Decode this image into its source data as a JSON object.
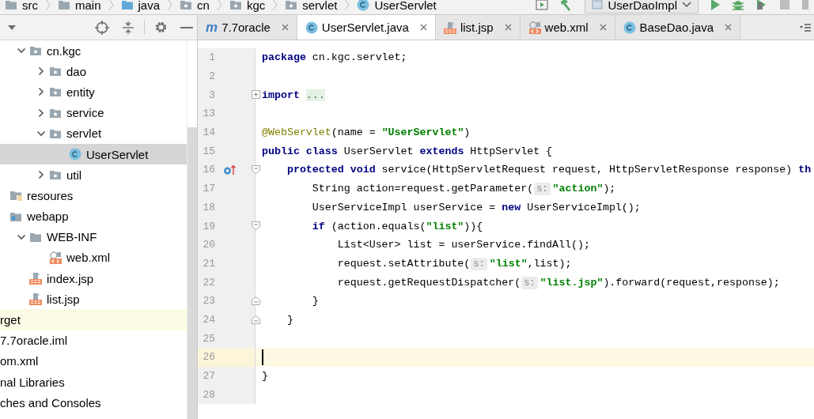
{
  "breadcrumbs": [
    {
      "kind": "folder",
      "label": "src"
    },
    {
      "kind": "folder",
      "label": "main"
    },
    {
      "kind": "source-root",
      "label": "java"
    },
    {
      "kind": "package",
      "label": "cn"
    },
    {
      "kind": "package",
      "label": "kgc"
    },
    {
      "kind": "package",
      "label": "servlet"
    },
    {
      "kind": "class",
      "label": "UserServlet"
    }
  ],
  "run_configuration": {
    "label": "UserDaoImpl"
  },
  "project_tree": [
    {
      "kind": "offscreen",
      "children": [
        {
          "kind": "offscreen",
          "children": [
            {
              "kind": "offscreen",
              "children": [
                {
                  "kind": "package",
                  "label": "cn.kgc",
                  "expanded": true,
                  "selected": false,
                  "excluded": false,
                  "children": [
                    {
                      "kind": "package",
                      "label": "dao",
                      "expanded": false,
                      "selected": false,
                      "excluded": false
                    },
                    {
                      "kind": "package",
                      "label": "entity",
                      "expanded": false,
                      "selected": false,
                      "excluded": false
                    },
                    {
                      "kind": "package",
                      "label": "service",
                      "expanded": false,
                      "selected": false,
                      "excluded": false
                    },
                    {
                      "kind": "package",
                      "label": "servlet",
                      "expanded": true,
                      "selected": false,
                      "excluded": false,
                      "children": [
                        {
                          "kind": "class",
                          "label": "UserServlet",
                          "selected": true,
                          "excluded": false
                        }
                      ]
                    },
                    {
                      "kind": "package",
                      "label": "util",
                      "expanded": false,
                      "selected": false,
                      "excluded": false
                    }
                  ]
                }
              ]
            },
            {
              "kind": "resources",
              "label": "resoures",
              "selected": false,
              "excluded": false
            },
            {
              "kind": "webroot",
              "label": "webapp",
              "selected": false,
              "excluded": false,
              "children": [
                {
                  "kind": "folder",
                  "label": "WEB-INF",
                  "expanded": true,
                  "selected": false,
                  "excluded": false,
                  "children": [
                    {
                      "kind": "xml",
                      "label": "web.xml",
                      "selected": false,
                      "excluded": false
                    }
                  ]
                },
                {
                  "kind": "jsp",
                  "label": "index.jsp",
                  "selected": false,
                  "excluded": false
                },
                {
                  "kind": "jsp",
                  "label": "list.jsp",
                  "selected": false,
                  "excluded": false
                }
              ]
            }
          ]
        }
      ]
    },
    {
      "kind": "folder",
      "label": "rget",
      "selected": false,
      "excluded": true
    },
    {
      "kind": "module-file",
      "label": "7.7oracle.iml",
      "selected": false,
      "excluded": false
    },
    {
      "kind": "xml",
      "label": "om.xml",
      "selected": false,
      "excluded": false
    },
    {
      "kind": "libraries",
      "label": "nal Libraries",
      "selected": false,
      "excluded": false
    },
    {
      "kind": "scratches",
      "label": "ches and Consoles",
      "selected": false,
      "excluded": false
    }
  ],
  "tabs": [
    {
      "kind": "module",
      "icon_text": "m",
      "label": "7.7oracle",
      "selected": false
    },
    {
      "kind": "class",
      "label": "UserServlet.java",
      "selected": true
    },
    {
      "kind": "jsp",
      "label": "list.jsp",
      "selected": false
    },
    {
      "kind": "xml",
      "label": "web.xml",
      "selected": false
    },
    {
      "kind": "class",
      "label": "BaseDao.java",
      "selected": false
    }
  ],
  "editor": {
    "lines": [
      {
        "number": "1",
        "current": false,
        "segments": [
          {
            "kind": "keyword",
            "text": "package"
          },
          {
            "kind": "plain",
            "text": " cn.kgc.servlet;"
          }
        ]
      },
      {
        "number": "2",
        "current": false
      },
      {
        "number": "3",
        "current": false,
        "fold": {
          "kind": "collapsed"
        },
        "segments": [
          {
            "kind": "keyword",
            "text": "import "
          },
          {
            "kind": "folded",
            "text": "..."
          }
        ]
      },
      {
        "number": "13",
        "current": false
      },
      {
        "number": "14",
        "current": false,
        "segments": [
          {
            "kind": "annotation",
            "text": "@WebServlet"
          },
          {
            "kind": "plain",
            "text": "(name = "
          },
          {
            "kind": "string",
            "text": "\"UserServlet\""
          },
          {
            "kind": "plain",
            "text": ")"
          }
        ]
      },
      {
        "number": "15",
        "current": false,
        "segments": [
          {
            "kind": "keyword",
            "text": "public"
          },
          {
            "kind": "keyword",
            "text": " class"
          },
          {
            "kind": "plain",
            "text": " UserServlet "
          },
          {
            "kind": "keyword",
            "text": "extends"
          },
          {
            "kind": "plain",
            "text": " HttpServlet {"
          }
        ]
      },
      {
        "number": "16",
        "current": false,
        "fold": {
          "kind": "start"
        },
        "marker": {
          "kind": "override"
        },
        "segments": [
          {
            "kind": "keyword",
            "text": "    protected"
          },
          {
            "kind": "keyword",
            "text": " void"
          },
          {
            "kind": "plain",
            "text": " service(HttpServletRequest request, HttpServletResponse response) "
          },
          {
            "kind": "keyword",
            "text": "th"
          }
        ]
      },
      {
        "number": "17",
        "current": false,
        "segments": [
          {
            "kind": "plain",
            "text": "        String action=request.getParameter("
          },
          {
            "kind": "hint",
            "text": "s:"
          },
          {
            "kind": "string",
            "text": "\"action\""
          },
          {
            "kind": "plain",
            "text": ");"
          }
        ]
      },
      {
        "number": "18",
        "current": false,
        "segments": [
          {
            "kind": "plain",
            "text": "        UserServiceImpl userService = "
          },
          {
            "kind": "keyword",
            "text": "new"
          },
          {
            "kind": "plain",
            "text": " UserServiceImpl();"
          }
        ]
      },
      {
        "number": "19",
        "current": false,
        "fold": {
          "kind": "start"
        },
        "segments": [
          {
            "kind": "keyword",
            "text": "        if"
          },
          {
            "kind": "plain",
            "text": " (action.equals("
          },
          {
            "kind": "string",
            "text": "\"list\""
          },
          {
            "kind": "plain",
            "text": ")){"
          }
        ]
      },
      {
        "number": "20",
        "current": false,
        "segments": [
          {
            "kind": "plain",
            "text": "            List<User> list = userService.findAll();"
          }
        ]
      },
      {
        "number": "21",
        "current": false,
        "segments": [
          {
            "kind": "plain",
            "text": "            request.setAttribute("
          },
          {
            "kind": "hint",
            "text": "s:"
          },
          {
            "kind": "string",
            "text": "\"list\""
          },
          {
            "kind": "plain",
            "text": ",list);"
          }
        ]
      },
      {
        "number": "22",
        "current": false,
        "segments": [
          {
            "kind": "plain",
            "text": "            request.getRequestDispatcher("
          },
          {
            "kind": "hint",
            "text": "s:"
          },
          {
            "kind": "string",
            "text": "\"list.jsp\""
          },
          {
            "kind": "plain",
            "text": ").forward(request,response);"
          }
        ]
      },
      {
        "number": "23",
        "current": false,
        "fold": {
          "kind": "end"
        },
        "segments": [
          {
            "kind": "plain",
            "text": "        }"
          }
        ]
      },
      {
        "number": "24",
        "current": false,
        "fold": {
          "kind": "end"
        },
        "segments": [
          {
            "kind": "plain",
            "text": "    }"
          }
        ]
      },
      {
        "number": "25",
        "current": false
      },
      {
        "number": "26",
        "current": true
      },
      {
        "number": "27",
        "current": false,
        "segments": [
          {
            "kind": "plain",
            "text": "}"
          }
        ]
      },
      {
        "number": "28",
        "current": false
      }
    ]
  }
}
